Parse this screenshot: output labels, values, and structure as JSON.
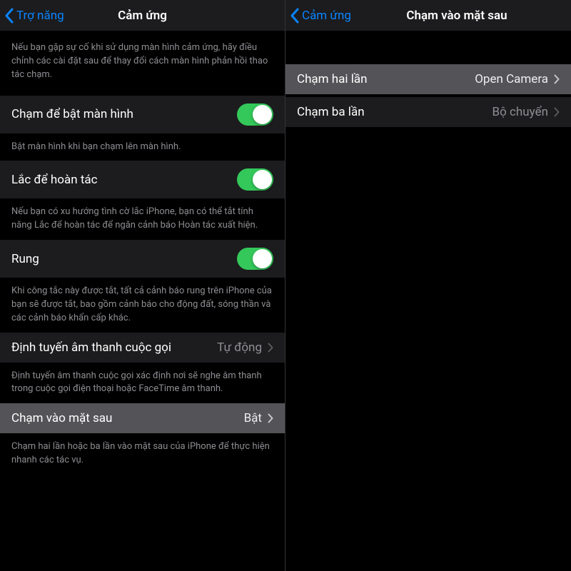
{
  "colors": {
    "accent": "#0a84ff",
    "toggleOn": "#34c85a",
    "textPrimary": "#ffffff",
    "textSecondary": "#8e8e93",
    "rowBg": "#1c1c1e",
    "rowSelected": "#545458"
  },
  "left": {
    "nav": {
      "back": "Trợ năng",
      "title": "Cảm ứng"
    },
    "introDesc": "Nếu bạn gặp sự cố khi sử dụng màn hình cảm ứng, hãy điều chỉnh các cài đặt sau để thay đổi cách màn hình phản hồi thao tác chạm.",
    "tapToWake": {
      "label": "Chạm để bật màn hình",
      "desc": "Bật màn hình khi bạn chạm lên màn hình.",
      "on": true
    },
    "shakeUndo": {
      "label": "Lắc để hoàn tác",
      "desc": "Nếu bạn có xu hướng tình cờ lắc iPhone, bạn có thể tắt tính năng Lắc để hoàn tác để ngăn cảnh báo Hoàn tác xuất hiện.",
      "on": true
    },
    "vibrate": {
      "label": "Rung",
      "desc": "Khi công tắc này được tắt, tất cả cảnh báo rung trên iPhone của bạn sẽ được tắt, bao gồm cảnh báo cho động đất, sóng thần và các cảnh báo khẩn cấp khác.",
      "on": true
    },
    "audioRouting": {
      "label": "Định tuyến âm thanh cuộc gọi",
      "value": "Tự động",
      "desc": "Định tuyến âm thanh cuộc gọi xác định nơi sẽ nghe âm thanh trong cuộc gọi điện thoại hoặc FaceTime âm thanh."
    },
    "backTap": {
      "label": "Chạm vào mặt sau",
      "value": "Bật",
      "desc": "Chạm hai lần hoặc ba lần vào mặt sau của iPhone để thực hiện nhanh các tác vụ."
    }
  },
  "right": {
    "nav": {
      "back": "Cảm ứng",
      "title": "Chạm vào mặt sau"
    },
    "doubleTap": {
      "label": "Chạm hai lần",
      "value": "Open Camera"
    },
    "tripleTap": {
      "label": "Chạm ba lần",
      "value": "Bộ chuyển"
    }
  }
}
